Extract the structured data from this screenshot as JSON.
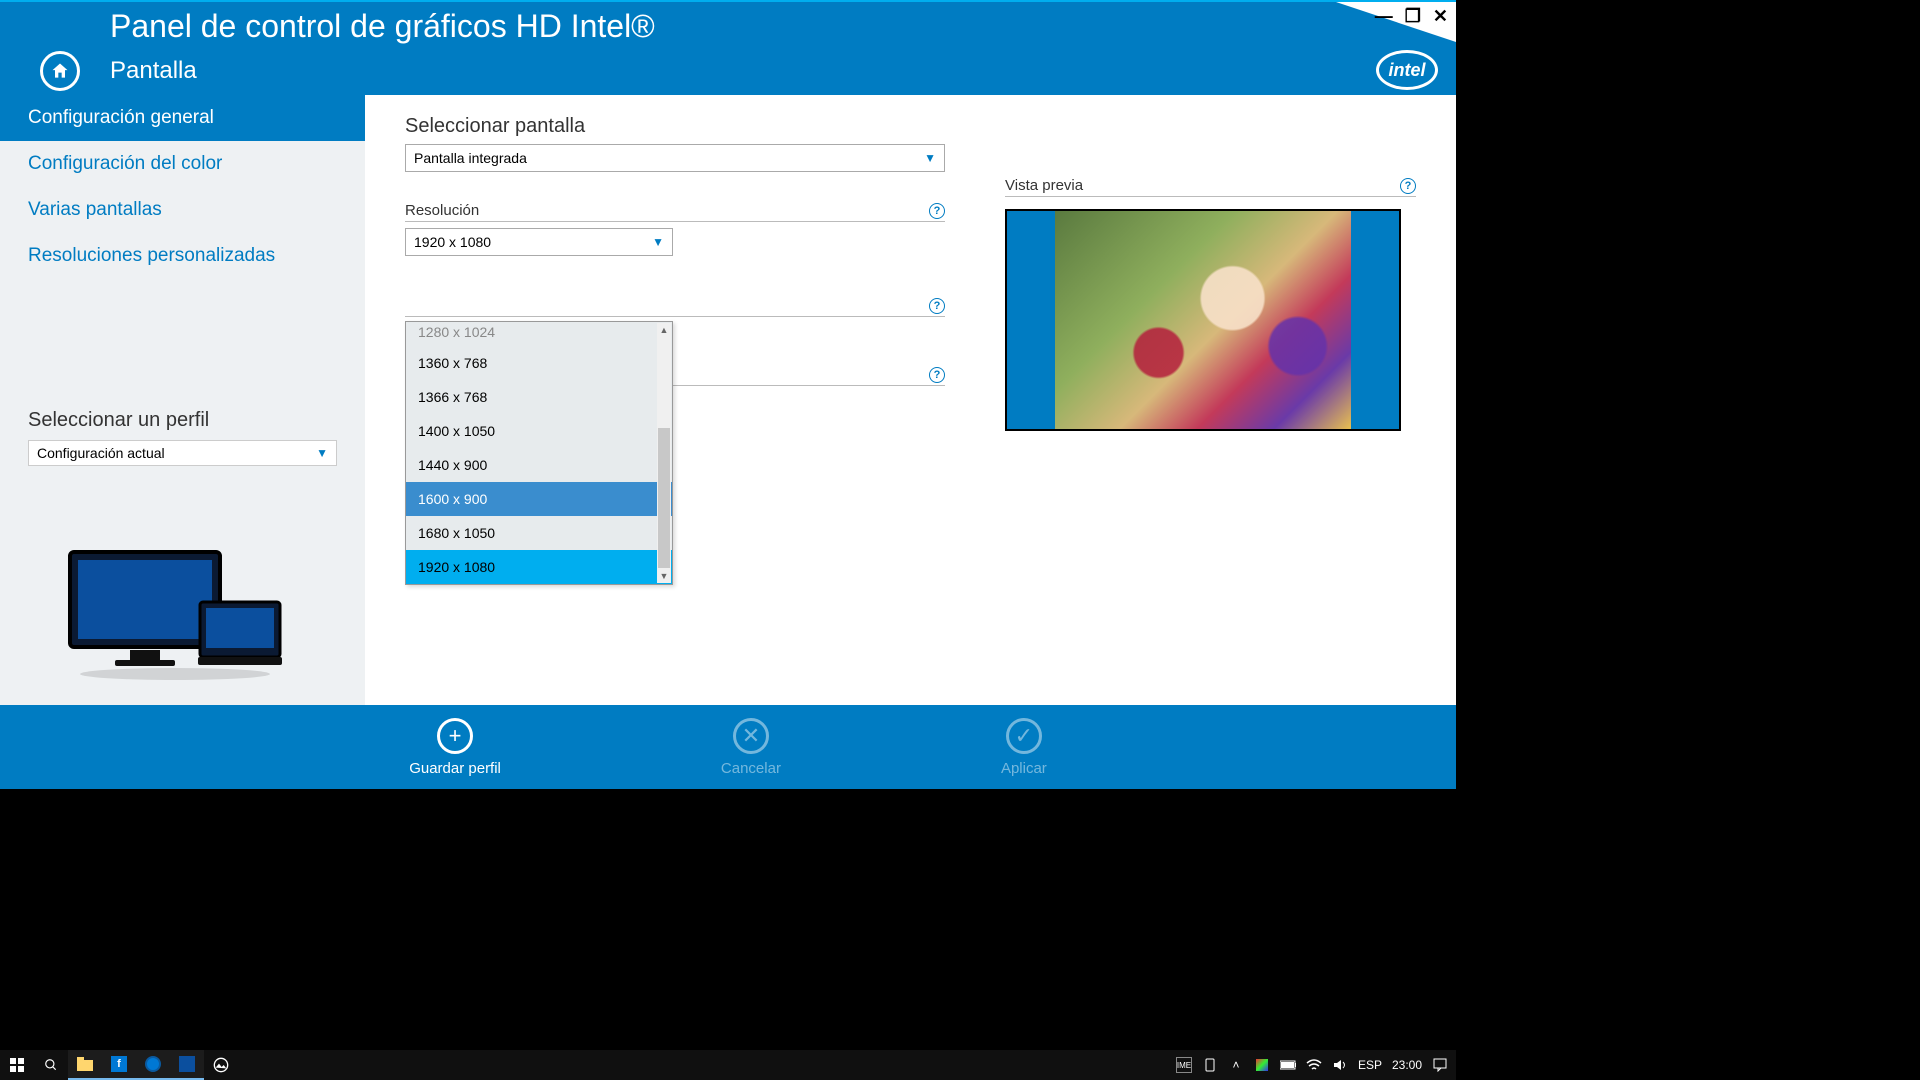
{
  "header": {
    "title": "Panel de control de gráficos HD Intel®",
    "section": "Pantalla",
    "logo_text": "intel"
  },
  "sidebar": {
    "items": [
      {
        "label": "Configuración general",
        "active": true
      },
      {
        "label": "Configuración del color",
        "active": false
      },
      {
        "label": "Varias pantallas",
        "active": false
      },
      {
        "label": "Resoluciones personalizadas",
        "active": false
      }
    ],
    "profile_label": "Seleccionar un perfil",
    "profile_value": "Configuración actual"
  },
  "main": {
    "select_display_label": "Seleccionar pantalla",
    "select_display_value": "Pantalla integrada",
    "resolution_label": "Resolución",
    "resolution_value": "1920 x 1080",
    "resolution_options": [
      {
        "label": "1280 x 1024",
        "state": "cut"
      },
      {
        "label": "1360 x 768",
        "state": ""
      },
      {
        "label": "1366 x 768",
        "state": ""
      },
      {
        "label": "1400 x 1050",
        "state": ""
      },
      {
        "label": "1440 x 900",
        "state": ""
      },
      {
        "label": "1600 x 900",
        "state": "hover"
      },
      {
        "label": "1680 x 1050",
        "state": ""
      },
      {
        "label": "1920 x 1080",
        "state": "selected"
      }
    ],
    "preview_label": "Vista previa"
  },
  "footer": {
    "save_profile": "Guardar perfil",
    "cancel": "Cancelar",
    "apply": "Aplicar"
  },
  "taskbar": {
    "lang": "ESP",
    "time": "23:00",
    "ime": "IME"
  }
}
